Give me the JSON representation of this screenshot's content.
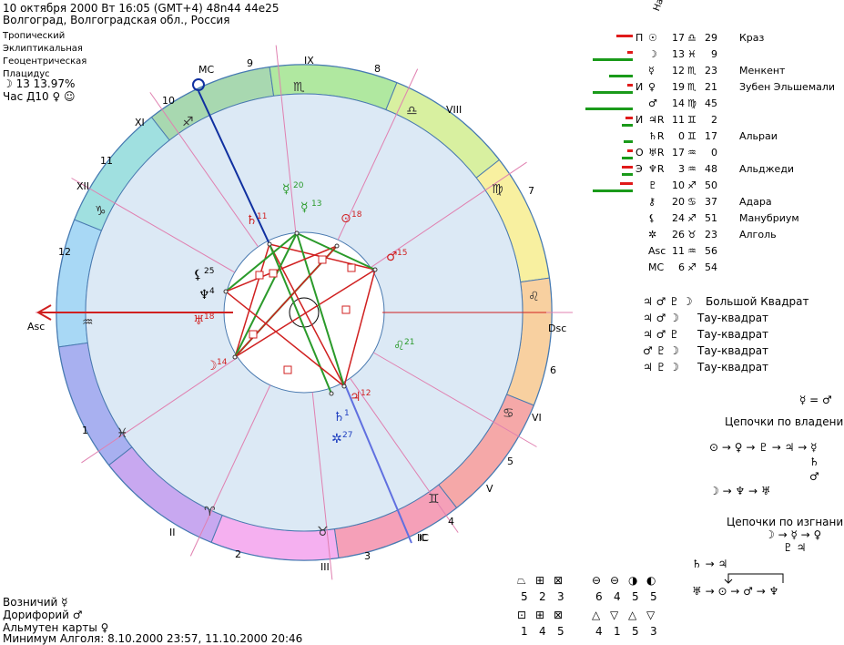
{
  "header": {
    "line1": "10 октября 2000  Вт  16:05 (GMT+4) 48n44  44e25",
    "line2": "Волгоград, Волгоградская обл., Россия"
  },
  "settings": {
    "zodiac": "Тропический",
    "coords": "Эклиптикальная",
    "center": "Геоцентрическая",
    "houses": "Плацидус",
    "moon_phase": "☽  13 13.97%",
    "hour": "Час Д10 ♀ ☺"
  },
  "wheel": {
    "house_numbers": [
      "1",
      "2",
      "3",
      "4",
      "5",
      "6",
      "7",
      "8",
      "9",
      "10",
      "11",
      "12"
    ],
    "roman": [
      "I",
      "II",
      "III",
      "IC",
      "V",
      "VI",
      "VII",
      "VIII",
      "IX",
      "MC",
      "XI",
      "XII"
    ],
    "angles": {
      "asc": "Asc",
      "dsc": "Dsc",
      "mc": "MC",
      "ic": "IC"
    },
    "planets": [
      {
        "glyph": "☿",
        "deg": "20",
        "color": "#2a9a2a"
      },
      {
        "glyph": "☿",
        "deg": "13",
        "color": "#2a9a2a"
      },
      {
        "glyph": "⊙",
        "deg": "18",
        "color": "#d02020"
      },
      {
        "glyph": "♂",
        "deg": "15",
        "color": "#d02020"
      },
      {
        "glyph": "♄",
        "deg": "11",
        "color": "#d02020"
      },
      {
        "glyph": "⚸",
        "deg": "25",
        "color": "#000000"
      },
      {
        "glyph": "♆",
        "deg": "4",
        "color": "#000000"
      },
      {
        "glyph": "♅",
        "deg": "18",
        "color": "#d02020"
      },
      {
        "glyph": "☽",
        "deg": "14",
        "color": "#d02020"
      },
      {
        "glyph": "♃",
        "deg": "12",
        "color": "#d02020"
      },
      {
        "glyph": "♄",
        "deg": "1",
        "color": "#2040c0"
      },
      {
        "glyph": "✲",
        "deg": "27",
        "color": "#2040c0"
      },
      {
        "glyph": "♌",
        "deg": "21",
        "color": "#2a9a2a"
      }
    ]
  },
  "planet_table": {
    "column_header": "Нат",
    "rows": [
      {
        "mark": "П",
        "glyph": "☉",
        "deg": "17",
        "sign": "♎",
        "min": "29",
        "star": "Краз",
        "red": 18,
        "green": 0
      },
      {
        "mark": "",
        "glyph": "☽",
        "deg": "13",
        "sign": "♓",
        "min": "9",
        "star": "",
        "red": 6,
        "green": 44
      },
      {
        "mark": "",
        "glyph": "☿",
        "deg": "12",
        "sign": "♏",
        "min": "23",
        "star": "Менкент",
        "red": 0,
        "green": 26
      },
      {
        "mark": "И",
        "glyph": "♀",
        "deg": "19",
        "sign": "♏",
        "min": "21",
        "star": "Зубен Эльшемали",
        "red": 6,
        "green": 44
      },
      {
        "mark": "",
        "glyph": "♂",
        "deg": "14",
        "sign": "♍",
        "min": "45",
        "star": "",
        "red": 0,
        "green": 52
      },
      {
        "mark": "И",
        "glyph": "♃R",
        "deg": "11",
        "sign": "♊",
        "min": "2",
        "star": "",
        "red": 8,
        "green": 12
      },
      {
        "mark": "",
        "glyph": "♄R",
        "deg": "0",
        "sign": "♊",
        "min": "17",
        "star": "Альраи",
        "red": 0,
        "green": 10
      },
      {
        "mark": "О",
        "glyph": "♅R",
        "deg": "17",
        "sign": "♒",
        "min": "0",
        "star": "",
        "red": 6,
        "green": 12
      },
      {
        "mark": "Э",
        "glyph": "♆R",
        "deg": "3",
        "sign": "♒",
        "min": "48",
        "star": "Альджеди",
        "red": 12,
        "green": 12
      },
      {
        "mark": "",
        "glyph": "♇",
        "deg": "10",
        "sign": "♐",
        "min": "50",
        "star": "",
        "red": 14,
        "green": 44
      },
      {
        "mark": "",
        "glyph": "⚷",
        "deg": "20",
        "sign": "♋",
        "min": "37",
        "star": "Адара",
        "red": 0,
        "green": 0
      },
      {
        "mark": "",
        "glyph": "⚸",
        "deg": "24",
        "sign": "♐",
        "min": "51",
        "star": "Манубриум",
        "red": 0,
        "green": 0
      },
      {
        "mark": "",
        "glyph": "✲",
        "deg": "26",
        "sign": "♉",
        "min": "23",
        "star": "Алголь",
        "red": 0,
        "green": 0
      },
      {
        "mark": "",
        "glyph": "Asc",
        "deg": "11",
        "sign": "♒",
        "min": "56",
        "star": "",
        "red": 0,
        "green": 0
      },
      {
        "mark": "",
        "glyph": "MC",
        "deg": "6",
        "sign": "♐",
        "min": "54",
        "star": "",
        "red": 0,
        "green": 0
      }
    ]
  },
  "configurations": [
    {
      "glyphs": "♃ ♂ ♇ ☽",
      "label": "Большой Квадрат"
    },
    {
      "glyphs": "♃ ♂ ☽",
      "label": "Тау-квадрат"
    },
    {
      "glyphs": "♃ ♂ ♇",
      "label": "Тау-квадрат"
    },
    {
      "glyphs": "♂ ♇ ☽",
      "label": "Тау-квадрат"
    },
    {
      "glyphs": "♃ ♇ ☽",
      "label": "Тау-квадрат"
    }
  ],
  "chains": {
    "equality": "☿ = ♂",
    "ownership_title": "Цепочки по владению",
    "ownership_1": "⊙ → ♀ → ♇ → ♃ → ☿",
    "ownership_1b": "♄",
    "ownership_1c": "♂",
    "ownership_2": "☽ → ♆ → ♅",
    "exile_title": "Цепочки по изгнанию",
    "exile_1": "☽ → ☿ → ♀",
    "exile_1b": "♇ ♃",
    "exile_2": "♄ → ♃",
    "exile_3": "♅ → ⊙ → ♂ → ♆"
  },
  "bottom_info": {
    "charioteer": "Возничий  ☿",
    "doryphory": "Дорифорий  ♂",
    "almuten": "Альмутен карты  ♀",
    "algol_min": "Минимум Алголя: 8.10.2000 23:57,  11.10.2000 20:46"
  },
  "elements": {
    "row1_icons": [
      "⏢",
      "⊞",
      "⊠",
      "⊖",
      "⊖",
      "◑",
      "◐"
    ],
    "row1_vals": [
      "5",
      "2",
      "3",
      "6",
      "4",
      "5",
      "5"
    ],
    "row2_icons": [
      "⊡",
      "⊞",
      "⊠",
      "△",
      "▽",
      "△",
      "▽"
    ],
    "row2_vals": [
      "1",
      "4",
      "5",
      "4",
      "1",
      "5",
      "3"
    ]
  }
}
